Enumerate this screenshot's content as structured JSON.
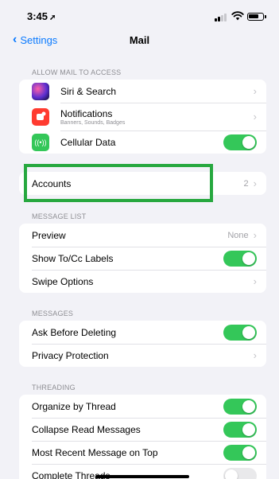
{
  "status": {
    "time": "3:45",
    "location_glyph": "➚"
  },
  "nav": {
    "back_label": "Settings",
    "title": "Mail"
  },
  "allow_access": {
    "header": "ALLOW MAIL TO ACCESS",
    "siri": {
      "label": "Siri & Search",
      "icon": "siri-icon"
    },
    "notifications": {
      "label": "Notifications",
      "sub": "Banners, Sounds, Badges",
      "icon": "notification-bell-icon"
    },
    "cellular": {
      "label": "Cellular Data",
      "icon": "antenna-icon",
      "enabled": true
    }
  },
  "accounts": {
    "label": "Accounts",
    "count": "2"
  },
  "message_list": {
    "header": "MESSAGE LIST",
    "preview": {
      "label": "Preview",
      "value": "None"
    },
    "show_to_cc": {
      "label": "Show To/Cc Labels",
      "enabled": true
    },
    "swipe": {
      "label": "Swipe Options"
    }
  },
  "messages": {
    "header": "MESSAGES",
    "ask_before_deleting": {
      "label": "Ask Before Deleting",
      "enabled": true
    },
    "privacy": {
      "label": "Privacy Protection"
    }
  },
  "threading": {
    "header": "THREADING",
    "organize": {
      "label": "Organize by Thread",
      "enabled": true
    },
    "collapse": {
      "label": "Collapse Read Messages",
      "enabled": true
    },
    "most_recent": {
      "label": "Most Recent Message on Top",
      "enabled": true
    },
    "complete": {
      "label": "Complete Threads",
      "enabled": false
    }
  },
  "colors": {
    "accent": "#0a7aff",
    "toggle_on": "#34c759",
    "highlight": "#27a83f",
    "siri": "#3a3a8c",
    "notifications": "#ff3b30",
    "cellular": "#34c759"
  }
}
